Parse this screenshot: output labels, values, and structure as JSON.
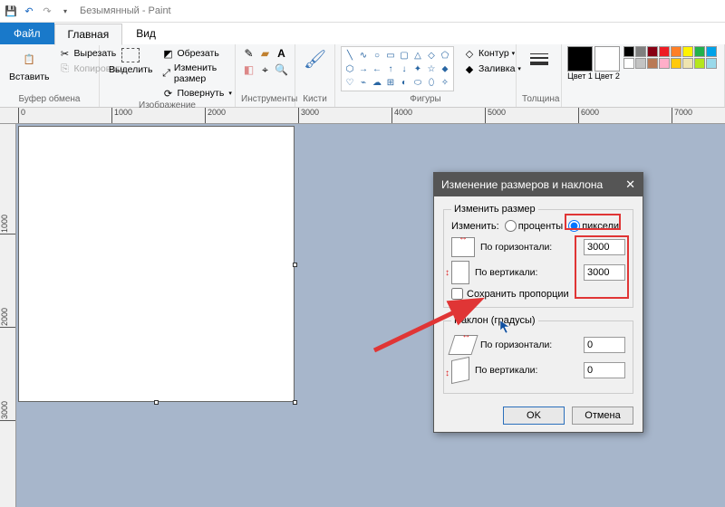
{
  "window": {
    "title": "Безымянный - Paint"
  },
  "tabs": {
    "file": "Файл",
    "home": "Главная",
    "view": "Вид"
  },
  "ribbon": {
    "clipboard": {
      "label": "Буфер обмена",
      "paste": "Вставить",
      "cut": "Вырезать",
      "copy": "Копировать"
    },
    "image": {
      "label": "Изображение",
      "select": "Выделить",
      "crop": "Обрезать",
      "resize": "Изменить размер",
      "rotate": "Повернуть"
    },
    "tools": {
      "label": "Инструменты"
    },
    "brushes": {
      "label": "Кисти"
    },
    "shapes": {
      "label": "Фигуры",
      "outline": "Контур",
      "fill": "Заливка"
    },
    "thickness": {
      "label": "Толщина"
    },
    "colors": {
      "c1": "Цвет 1",
      "c2": "Цвет 2"
    }
  },
  "ruler": {
    "marks_h": [
      "0",
      "1000",
      "2000",
      "3000",
      "4000",
      "5000",
      "6000",
      "7000"
    ],
    "marks_v": [
      "1000",
      "2000",
      "3000"
    ]
  },
  "dialog": {
    "title": "Изменение размеров и наклона",
    "resize_group": "Изменить размер",
    "by_label": "Изменить:",
    "percent": "проценты",
    "pixels": "пиксели",
    "horizontal": "По горизонтали:",
    "vertical": "По вертикали:",
    "h_value": "3000",
    "v_value": "3000",
    "keep_aspect": "Сохранить пропорции",
    "skew_group": "Наклон (градусы)",
    "skew_h": "По горизонтали:",
    "skew_v": "По вертикали:",
    "skew_h_value": "0",
    "skew_v_value": "0",
    "ok": "OK",
    "cancel": "Отмена"
  },
  "colors": {
    "c1": "#000000",
    "c2": "#ffffff",
    "palette": [
      "#000000",
      "#7f7f7f",
      "#870014",
      "#ed1c24",
      "#ff7f27",
      "#fff200",
      "#22b14c",
      "#00a2e8",
      "#ffffff",
      "#c3c3c3",
      "#b97a57",
      "#ffaec9",
      "#ffc90e",
      "#efe4b0",
      "#b5e61d",
      "#99d9ea"
    ]
  }
}
